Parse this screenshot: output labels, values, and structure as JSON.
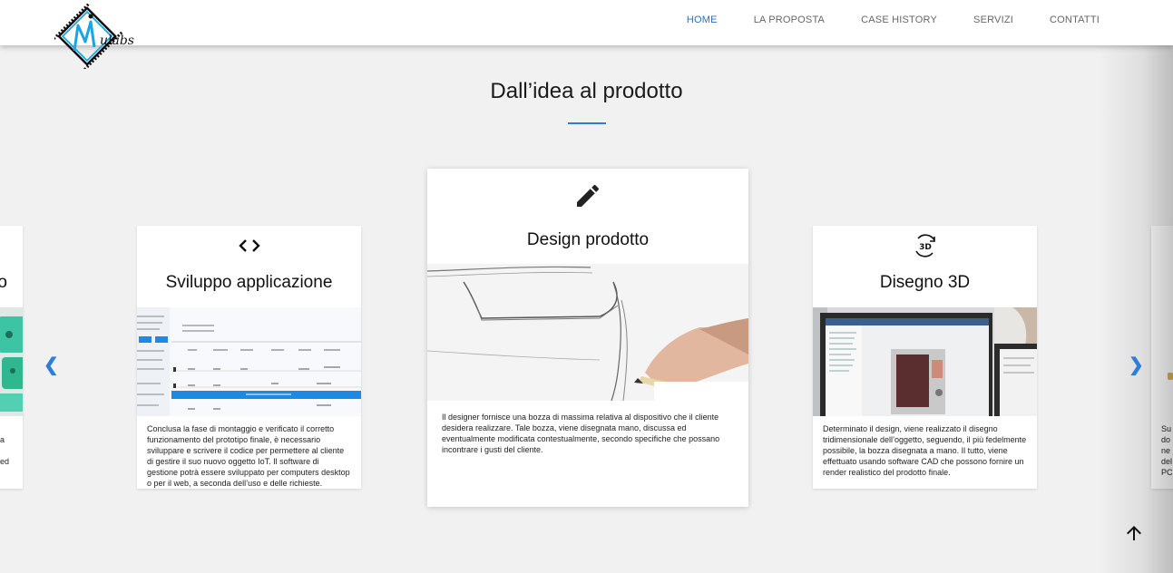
{
  "nav": {
    "items": [
      {
        "label": "HOME",
        "active": true
      },
      {
        "label": "LA PROPOSTA",
        "active": false
      },
      {
        "label": "CASE HISTORY",
        "active": false
      },
      {
        "label": "SERVIZI",
        "active": false
      },
      {
        "label": "CONTATTI",
        "active": false
      }
    ],
    "active_color": "#2d6fb8"
  },
  "logo": {
    "text": "Mulabs"
  },
  "section": {
    "title": "Dall’idea al prodotto",
    "accent": "#2d7ed8"
  },
  "carousel": {
    "prev_icon": "chevron-left-icon",
    "next_icon": "chevron-right-icon",
    "prev_glyph": "❮",
    "next_glyph": "❯",
    "cards": [
      {
        "id": "left-partial",
        "title_fragment": "o",
        "text_fragments": [
          "a",
          "ed"
        ]
      },
      {
        "id": "sviluppo",
        "icon": "code-icon",
        "title": "Sviluppo applicazione",
        "text": "Conclusa la fase di montaggio e verificato il corretto funzionamento del prototipo finale, è necessario sviluppare e scrivere il codice per permettere al cliente di gestire il suo nuovo oggetto IoT. Il software di gestione potrà essere sviluppato per computers desktop o per il web, a seconda dell’uso e delle richieste."
      },
      {
        "id": "design",
        "icon": "pencil-icon",
        "title": "Design prodotto",
        "text": "Il designer fornisce una bozza di massima relativa al dispositivo che il cliente desidera realizzare. Tale bozza, viene disegnata mano, discussa ed eventualmente modificata contestualmente, secondo specifiche che possano incontrare i gusti del cliente."
      },
      {
        "id": "disegno",
        "icon": "3d-rotation-icon",
        "title": "Disegno 3D",
        "text": "Determinato il design, viene realizzato il disegno tridimensionale dell’oggetto, seguendo, il più fedelmente possibile, la bozza disegnata a mano. Il tutto, viene effettuato usando software CAD che possono fornire un render realistico del prodotto finale."
      },
      {
        "id": "right-partial",
        "text_fragments": [
          "Su",
          "do",
          "ne",
          "del",
          "PC"
        ]
      }
    ]
  },
  "back_to_top_icon": "arrow-up-icon"
}
